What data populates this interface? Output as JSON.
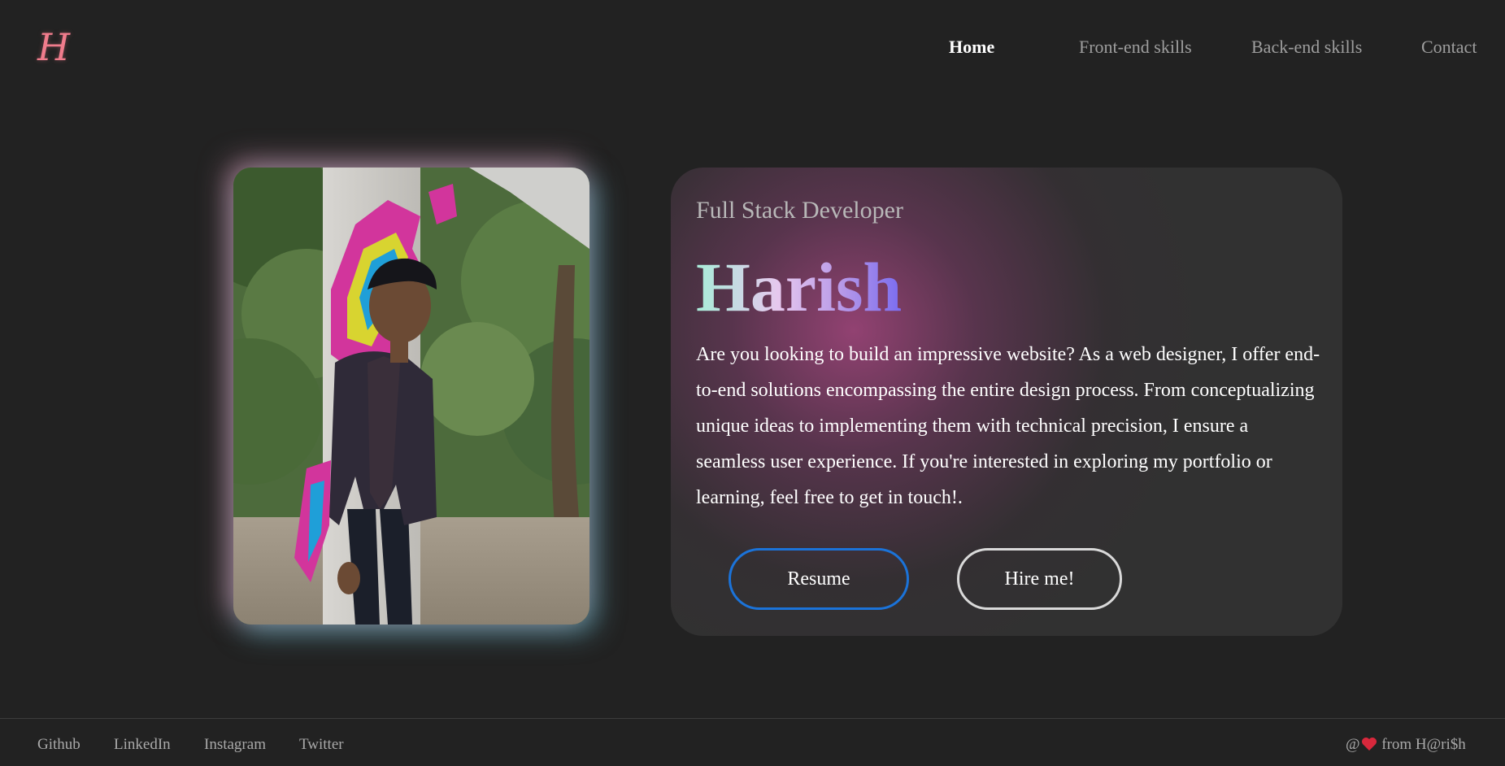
{
  "header": {
    "logo_text": "H",
    "nav": [
      {
        "label": "Home",
        "active": true
      },
      {
        "label": "Front-end skills",
        "active": false
      },
      {
        "label": "Back-end skills",
        "active": false
      },
      {
        "label": "Contact",
        "active": false
      }
    ]
  },
  "hero": {
    "subtitle": "Full Stack Developer",
    "name": "Harish",
    "description": "Are you looking to build an impressive website? As a web designer, I offer end-to-end solutions encompassing the entire design process. From conceptualizing unique ideas to implementing them with technical precision, I ensure a seamless user experience. If you're interested in exploring my portfolio or learning, feel free to get in touch!.",
    "buttons": {
      "resume": "Resume",
      "hire": "Hire me!"
    }
  },
  "footer": {
    "links": [
      "Github",
      "LinkedIn",
      "Instagram",
      "Twitter"
    ],
    "credit_prefix": "@",
    "credit_suffix": "from H@ri$h",
    "credit_icon": "heart-icon"
  },
  "colors": {
    "background": "#222222",
    "card": "#313131",
    "accent_blue": "#1b73d9",
    "logo": "#f07c8c",
    "heart": "#d8283c"
  }
}
